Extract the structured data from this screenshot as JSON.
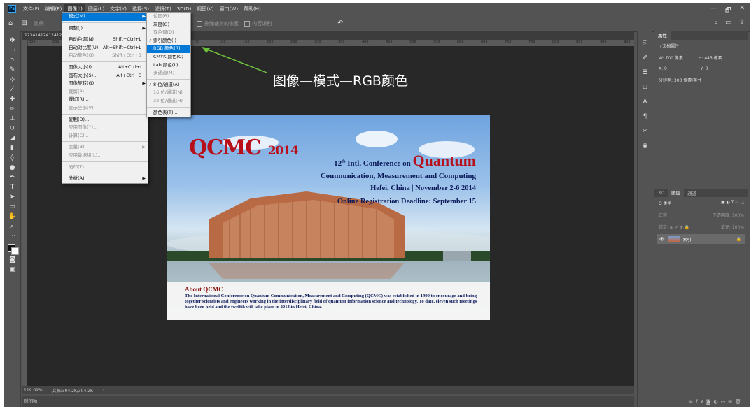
{
  "menubar": {
    "logo": "Ps",
    "items": [
      "文件(F)",
      "编辑(E)",
      "图像(I)",
      "图层(L)",
      "文字(Y)",
      "选择(S)",
      "滤镜(T)",
      "3D(D)",
      "视图(V)",
      "窗口(W)",
      "帮助(H)"
    ],
    "window_controls": [
      "—",
      "🗗",
      "✕"
    ]
  },
  "optbar": {
    "scale_label": "比例",
    "left_tag": "比例",
    "dims": "拉伸",
    "delete_cropped": "删除裁剪的像素",
    "content_aware": "内容识别",
    "reset": "↶"
  },
  "doc": {
    "tab_title": "12341412412412",
    "ruler_ticks": [
      "300",
      "250",
      "200",
      "150",
      "100",
      "50",
      "0",
      "50",
      "100",
      "150",
      "200",
      "250",
      "300",
      "350",
      "400",
      "450",
      "500",
      "550",
      "600",
      "650",
      "700",
      "750",
      "800",
      "850",
      "900",
      "950"
    ],
    "zoom": "119.09%",
    "doc_size": "文档:304.2K/304.2K",
    "timeline": "时间轴"
  },
  "image_menu": [
    {
      "label": "模式(M)",
      "arrow": true,
      "highlight": true
    },
    {
      "sep": true
    },
    {
      "label": "调整(J)",
      "arrow": true
    },
    {
      "sep": true
    },
    {
      "label": "自动色调(N)",
      "shortcut": "Shift+Ctrl+L"
    },
    {
      "label": "自动对比度(U)",
      "shortcut": "Alt+Shift+Ctrl+L"
    },
    {
      "label": "自动颜色(O)",
      "shortcut": "Shift+Ctrl+B",
      "disabled": true
    },
    {
      "sep": true
    },
    {
      "label": "图像大小(I)...",
      "shortcut": "Alt+Ctrl+I"
    },
    {
      "label": "画布大小(S)...",
      "shortcut": "Alt+Ctrl+C"
    },
    {
      "label": "图像旋转(G)",
      "arrow": true
    },
    {
      "label": "裁剪(P)",
      "disabled": true
    },
    {
      "label": "裁切(R)..."
    },
    {
      "label": "显示全部(V)",
      "disabled": true
    },
    {
      "sep": true
    },
    {
      "label": "复制(D)..."
    },
    {
      "label": "应用图像(Y)...",
      "disabled": true
    },
    {
      "label": "计算(C)...",
      "disabled": true
    },
    {
      "sep": true
    },
    {
      "label": "变量(B)",
      "arrow": true,
      "disabled": true
    },
    {
      "label": "应用数据组(L)...",
      "disabled": true
    },
    {
      "sep": true
    },
    {
      "label": "陷印(T)...",
      "disabled": true
    },
    {
      "sep": true
    },
    {
      "label": "分析(A)",
      "arrow": true
    }
  ],
  "mode_menu": [
    {
      "label": "位图(B)",
      "disabled": true
    },
    {
      "label": "灰度(G)"
    },
    {
      "label": "双色调(D)",
      "disabled": true
    },
    {
      "label": "索引颜色(I)",
      "check": true
    },
    {
      "label": "RGB 颜色(R)",
      "highlight": true
    },
    {
      "label": "CMYK 颜色(C)"
    },
    {
      "label": "Lab 颜色(L)"
    },
    {
      "label": "多通道(M)",
      "disabled": true
    },
    {
      "sep": true
    },
    {
      "label": "8 位/通道(A)",
      "check": true
    },
    {
      "label": "16 位/通道(N)",
      "disabled": true
    },
    {
      "label": "32 位/通道(H)",
      "disabled": true
    },
    {
      "sep": true
    },
    {
      "label": "颜色表(T)..."
    }
  ],
  "annotation": "图像—模式—RGB颜色",
  "banner": {
    "logo": "QCMC",
    "year": "2014",
    "line1_pre": "12",
    "line1_sup": "th",
    "line1_mid": " Intl. Conference on ",
    "line1_big": "Quantum",
    "line2": "Communication, Measurement and Computing",
    "line3": "Hefei, China | November 2-6 2014",
    "line4": "Online Registration Deadline: September 15",
    "about_title": "About QCMC",
    "about_text": "The International Conference on Quantum Communication, Measurement and Computing (QCMC) was established in 1990 to encourage and bring together scientists and engineers working in the interdisciplinary field of quantum information science and technology. To date, eleven such meetings have been held and the twelfth will take place in 2014 in Hefei, China."
  },
  "properties": {
    "tab": "属性",
    "doc_props": "文档属性",
    "width": "W: 700 像素",
    "height": "H: 445 像素",
    "x": "X: 0",
    "y": "Y: 0",
    "resolution": "分辨率: 300 像素/英寸"
  },
  "layers": {
    "tabs": [
      "3D",
      "图层",
      "通道"
    ],
    "kind": "Q 类型",
    "blend": "正常",
    "opacity": "不透明度: 100%",
    "lock": "锁定:",
    "fill": "填充: 100%",
    "layer_name": "索引"
  },
  "colors": {
    "highlight": "#0078d7",
    "arrow": "#6fbf3e"
  }
}
